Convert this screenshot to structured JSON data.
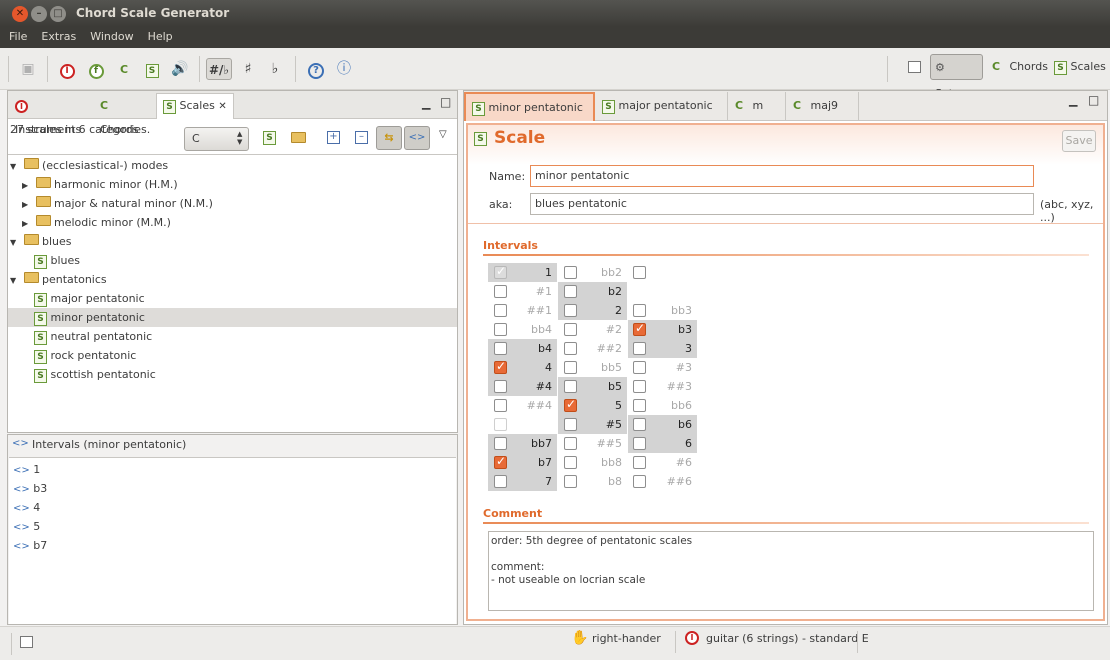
{
  "window": {
    "title": "Chord Scale Generator"
  },
  "menu": [
    "File",
    "Extras",
    "Window",
    "Help"
  ],
  "toolbar": {
    "perspectives": [
      {
        "label": "Setup",
        "icon": "setup-icon",
        "active": true
      },
      {
        "label": "Chords",
        "icon": "chord-icon",
        "active": false
      },
      {
        "label": "Scales",
        "icon": "scale-icon",
        "active": false
      }
    ],
    "sharp_glyph": "♯",
    "flat_glyph": "♭",
    "help_glyph": "?"
  },
  "left_panel": {
    "tabs": [
      "Instruments",
      "Chords",
      "Scales"
    ],
    "summary": "27 scales in 6 categories.",
    "key_select": "C",
    "tree": [
      {
        "label": "(ecclesiastical-) modes",
        "type": "folder",
        "level": 0,
        "expanded": true
      },
      {
        "label": "harmonic minor (H.M.)",
        "type": "folder",
        "level": 1,
        "expanded": false
      },
      {
        "label": "major & natural minor (N.M.)",
        "type": "folder",
        "level": 1,
        "expanded": false
      },
      {
        "label": "melodic minor (M.M.)",
        "type": "folder",
        "level": 1,
        "expanded": false
      },
      {
        "label": "blues",
        "type": "folder",
        "level": 0,
        "expanded": true
      },
      {
        "label": "blues",
        "type": "scale",
        "level": 1
      },
      {
        "label": "pentatonics",
        "type": "folder",
        "level": 0,
        "expanded": true
      },
      {
        "label": "major pentatonic",
        "type": "scale",
        "level": 1
      },
      {
        "label": "minor pentatonic",
        "type": "scale",
        "level": 1,
        "selected": true
      },
      {
        "label": "neutral pentatonic",
        "type": "scale",
        "level": 1
      },
      {
        "label": "rock pentatonic",
        "type": "scale",
        "level": 1
      },
      {
        "label": "scottish pentatonic",
        "type": "scale",
        "level": 1
      }
    ]
  },
  "intervals_panel": {
    "title": "Intervals (minor pentatonic)",
    "items": [
      "1",
      "b3",
      "4",
      "5",
      "b7"
    ]
  },
  "editor": {
    "tabs": [
      {
        "label": "minor pentatonic",
        "icon": "scale-icon",
        "active": true,
        "closable": true
      },
      {
        "label": "major pentatonic",
        "icon": "scale-icon",
        "active": false
      },
      {
        "label": "m",
        "icon": "chord-icon",
        "active": false
      },
      {
        "label": "maj9",
        "icon": "chord-icon",
        "active": false
      }
    ],
    "heading": "Scale",
    "save_label": "Save",
    "name_label": "Name:",
    "name_value": "minor pentatonic",
    "aka_label": "aka:",
    "aka_value": "blues pentatonic",
    "aka_hint": "(abc, xyz, ...)",
    "intervals_heading": "Intervals",
    "comment_heading": "Comment",
    "comment_lines": [
      "order: 5th degree of pentatonic scales",
      "",
      "comment:",
      "- not useable on locrian scale"
    ],
    "interval_columns": [
      [
        {
          "label": "1",
          "state": "on",
          "checkbox": "gray"
        },
        {
          "label": "#1",
          "state": "off",
          "checkbox": "empty"
        },
        {
          "label": "##1",
          "state": "off",
          "checkbox": "empty"
        },
        {
          "label": "bb4",
          "state": "off",
          "checkbox": "empty"
        },
        {
          "label": "b4",
          "state": "on",
          "checkbox": "empty"
        },
        {
          "label": "4",
          "state": "on",
          "checkbox": "checked"
        },
        {
          "label": "#4",
          "state": "on",
          "checkbox": "empty"
        },
        {
          "label": "##4",
          "state": "off",
          "checkbox": "empty"
        },
        {
          "label": "",
          "state": "blank",
          "checkbox": "faint"
        },
        {
          "label": "bb7",
          "state": "on",
          "checkbox": "empty"
        },
        {
          "label": "b7",
          "state": "on",
          "checkbox": "checked"
        },
        {
          "label": "7",
          "state": "on",
          "checkbox": "empty"
        }
      ],
      [
        {
          "label": "bb2",
          "state": "off",
          "checkbox": "empty"
        },
        {
          "label": "b2",
          "state": "on",
          "checkbox": "empty"
        },
        {
          "label": "2",
          "state": "on",
          "checkbox": "empty"
        },
        {
          "label": "#2",
          "state": "off",
          "checkbox": "empty"
        },
        {
          "label": "##2",
          "state": "off",
          "checkbox": "empty"
        },
        {
          "label": "bb5",
          "state": "off",
          "checkbox": "empty"
        },
        {
          "label": "b5",
          "state": "on",
          "checkbox": "empty"
        },
        {
          "label": "5",
          "state": "on",
          "checkbox": "checked"
        },
        {
          "label": "#5",
          "state": "on",
          "checkbox": "empty"
        },
        {
          "label": "##5",
          "state": "off",
          "checkbox": "empty"
        },
        {
          "label": "bb8",
          "state": "off",
          "checkbox": "empty"
        },
        {
          "label": "b8",
          "state": "off",
          "checkbox": "empty"
        }
      ],
      [
        {
          "label": "",
          "state": "blank",
          "checkbox": "empty"
        },
        {
          "label": "",
          "state": "blank",
          "checkbox": "none"
        },
        {
          "label": "bb3",
          "state": "off",
          "checkbox": "empty"
        },
        {
          "label": "b3",
          "state": "on",
          "checkbox": "checked"
        },
        {
          "label": "3",
          "state": "on",
          "checkbox": "empty"
        },
        {
          "label": "#3",
          "state": "off",
          "checkbox": "empty"
        },
        {
          "label": "##3",
          "state": "off",
          "checkbox": "empty"
        },
        {
          "label": "bb6",
          "state": "off",
          "checkbox": "empty"
        },
        {
          "label": "b6",
          "state": "on",
          "checkbox": "empty"
        },
        {
          "label": "6",
          "state": "on",
          "checkbox": "empty"
        },
        {
          "label": "#6",
          "state": "off",
          "checkbox": "empty"
        },
        {
          "label": "##6",
          "state": "off",
          "checkbox": "empty"
        }
      ]
    ]
  },
  "status": {
    "hand": "right-hander",
    "instrument": "guitar (6 strings) - standard E"
  }
}
